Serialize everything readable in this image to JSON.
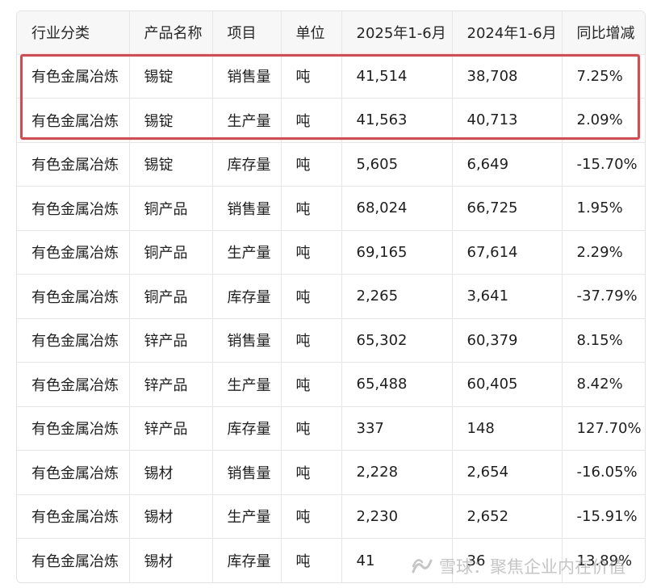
{
  "table": {
    "headers": [
      "行业分类",
      "产品名称",
      "项目",
      "单位",
      "2025年1-6月",
      "2024年1-6月",
      "同比增减"
    ],
    "rows": [
      [
        "有色金属冶炼",
        "锡锭",
        "销售量",
        "吨",
        "41,514",
        "38,708",
        "7.25%"
      ],
      [
        "有色金属冶炼",
        "锡锭",
        "生产量",
        "吨",
        "41,563",
        "40,713",
        "2.09%"
      ],
      [
        "有色金属冶炼",
        "锡锭",
        "库存量",
        "吨",
        "5,605",
        "6,649",
        "-15.70%"
      ],
      [
        "有色金属冶炼",
        "铜产品",
        "销售量",
        "吨",
        "68,024",
        "66,725",
        "1.95%"
      ],
      [
        "有色金属冶炼",
        "铜产品",
        "生产量",
        "吨",
        "69,165",
        "67,614",
        "2.29%"
      ],
      [
        "有色金属冶炼",
        "铜产品",
        "库存量",
        "吨",
        "2,265",
        "3,641",
        "-37.79%"
      ],
      [
        "有色金属冶炼",
        "锌产品",
        "销售量",
        "吨",
        "65,302",
        "60,379",
        "8.15%"
      ],
      [
        "有色金属冶炼",
        "锌产品",
        "生产量",
        "吨",
        "65,488",
        "60,405",
        "8.42%"
      ],
      [
        "有色金属冶炼",
        "锌产品",
        "库存量",
        "吨",
        "337",
        "148",
        "127.70%"
      ],
      [
        "有色金属冶炼",
        "锡材",
        "销售量",
        "吨",
        "2,228",
        "2,654",
        "-16.05%"
      ],
      [
        "有色金属冶炼",
        "锡材",
        "生产量",
        "吨",
        "2,230",
        "2,652",
        "-15.91%"
      ],
      [
        "有色金属冶炼",
        "锡材",
        "库存量",
        "吨",
        "41",
        "36",
        "13.89%"
      ]
    ]
  },
  "highlight": {
    "color": "#e8434a",
    "rows": [
      0,
      1
    ]
  },
  "watermark": {
    "text": "雪球：聚焦企业内在价值",
    "icon": "snowball-logo-icon"
  }
}
